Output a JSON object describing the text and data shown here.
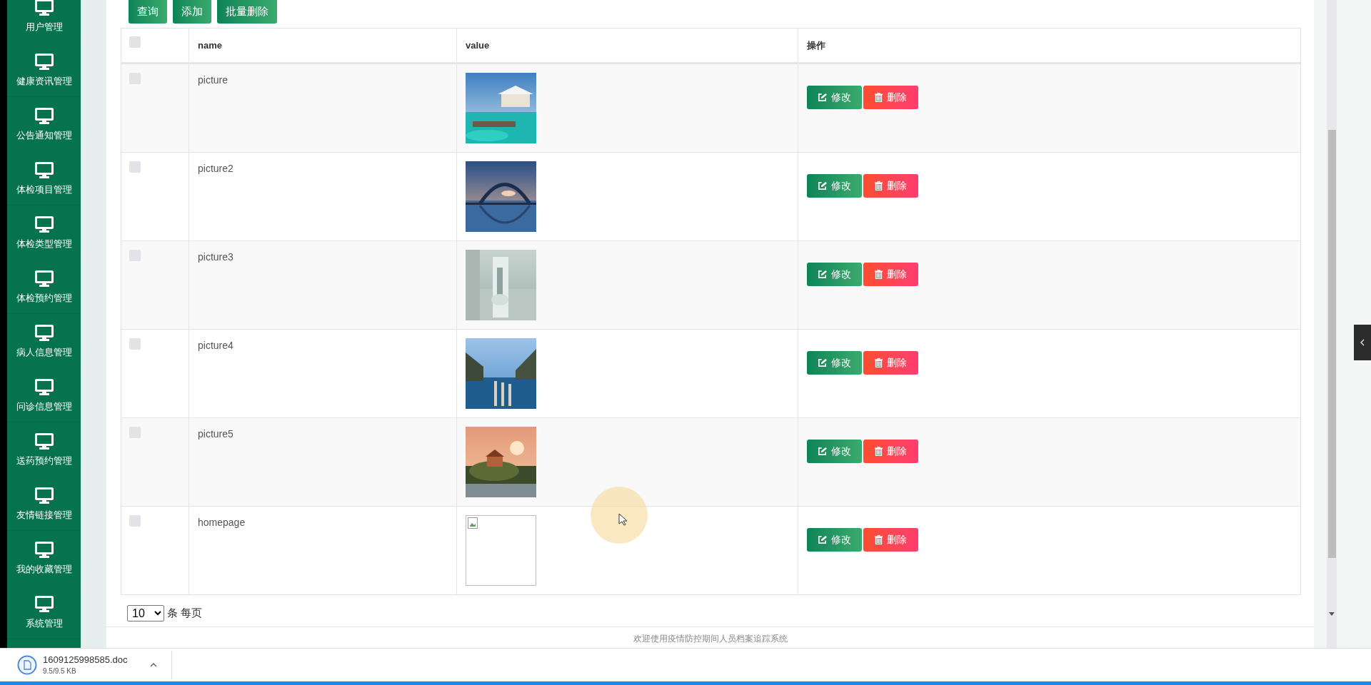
{
  "sidebar": {
    "items": [
      {
        "label": "用户管理"
      },
      {
        "label": "健康资讯管理"
      },
      {
        "label": "公告通知管理"
      },
      {
        "label": "体检项目管理"
      },
      {
        "label": "体检类型管理"
      },
      {
        "label": "体检预约管理"
      },
      {
        "label": "病人信息管理"
      },
      {
        "label": "问诊信息管理"
      },
      {
        "label": "送药预约管理"
      },
      {
        "label": "友情链接管理"
      },
      {
        "label": "我的收藏管理"
      },
      {
        "label": "系统管理"
      }
    ]
  },
  "toolbar": {
    "buttons": [
      {
        "label": "查询"
      },
      {
        "label": "添加"
      },
      {
        "label": "批量删除"
      }
    ]
  },
  "table": {
    "header_checked": false,
    "columns": [
      "name",
      "value",
      "操作"
    ],
    "rows": [
      {
        "checked": false,
        "name": "picture",
        "value": {
          "kind": "picture"
        },
        "actions": [
          "修改",
          "删除"
        ]
      },
      {
        "checked": false,
        "name": "picture2",
        "value": {
          "kind": "picture"
        },
        "actions": [
          "修改",
          "删除"
        ]
      },
      {
        "checked": false,
        "name": "picture3",
        "value": {
          "kind": "picture"
        },
        "actions": [
          "修改",
          "删除"
        ]
      },
      {
        "checked": false,
        "name": "picture4",
        "value": {
          "kind": "picture"
        },
        "actions": [
          "修改",
          "删除"
        ]
      },
      {
        "checked": false,
        "name": "picture5",
        "value": {
          "kind": "picture"
        },
        "actions": [
          "修改",
          "删除"
        ]
      },
      {
        "checked": false,
        "name": "homepage",
        "value": {
          "kind": "broken"
        },
        "actions": [
          "修改",
          "删除"
        ]
      }
    ]
  },
  "pagination": {
    "page_size": "10",
    "label": "条 每页"
  },
  "footer": {
    "text": "欢迎使用疫情防控期间人员档案追踪系统"
  },
  "download_bar": {
    "file_name": "1609125998585.doc",
    "size": "9.5/9.5 KB"
  }
}
